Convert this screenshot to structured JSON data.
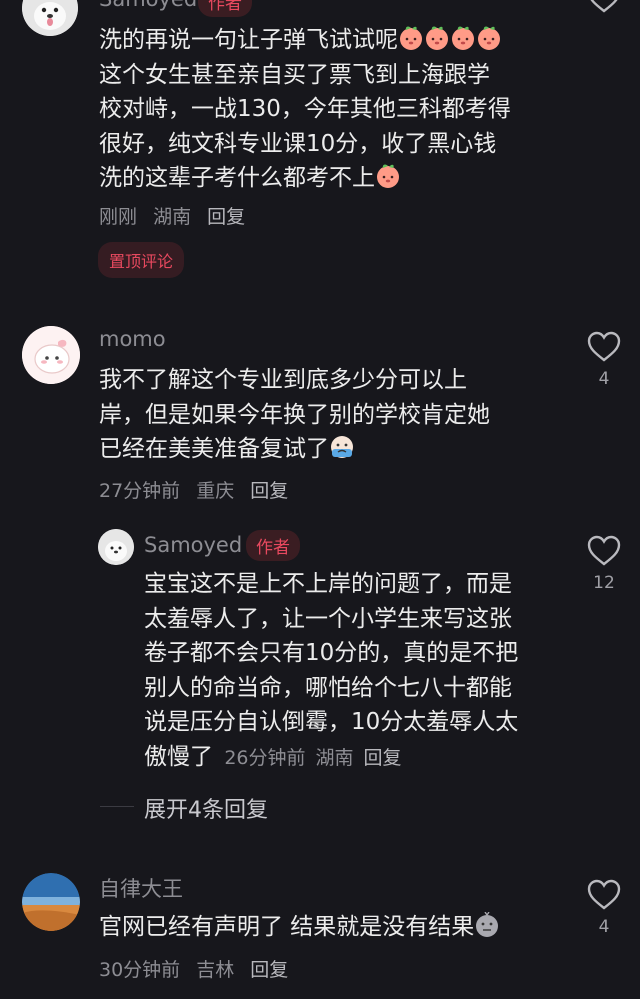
{
  "comments": [
    {
      "name": "Samoyed",
      "badge": "作者",
      "text_lines": [
        "洗的再说一句让子弹飞试试呢",
        "这个女生甚至亲自买了票飞到上海跟学",
        "校对峙，一战130，今年其他三科都考得",
        "很好，纯文科专业课10分，收了黑心钱",
        "洗的这辈子考什么都考不上"
      ],
      "time": "刚刚",
      "location": "湖南",
      "reply": "回复",
      "pinned_label": "置顶评论"
    },
    {
      "name": "momo",
      "text_lines": [
        "我不了解这个专业到底多少分可以上",
        "岸，但是如果今年换了别的学校肯定她",
        "已经在美美准备复试了"
      ],
      "time": "27分钟前",
      "location": "重庆",
      "reply": "回复",
      "likes": "4"
    },
    {
      "name": "Samoyed",
      "badge": "作者",
      "text_lines": [
        "宝宝这不是上不上岸的问题了，而是",
        "太羞辱人了，让一个小学生来写这张",
        "卷子都不会只有10分的，真的是不把",
        "别人的命当命，哪怕给个七八十都能",
        "说是压分自认倒霉，10分太羞辱人太",
        "傲慢了"
      ],
      "time": "26分钟前",
      "location": "湖南",
      "reply": "回复",
      "likes": "12",
      "expand_label": "展开4条回复"
    },
    {
      "name": "自律大王",
      "text_lines": [
        "官网已经有声明了 结果就是没有结果"
      ],
      "time": "30分钟前",
      "location": "吉林",
      "reply": "回复",
      "likes": "4"
    }
  ],
  "icons": {
    "like": "heart-outline-icon",
    "emoji_peach": "peach-face-emoji-icon",
    "emoji_cry": "crying-emoji-icon",
    "emoji_speechless": "speechless-emoji-icon"
  },
  "colors": {
    "background": "#17171c",
    "accent_red": "#e8495f",
    "meta_gray": "#8d8d93"
  }
}
